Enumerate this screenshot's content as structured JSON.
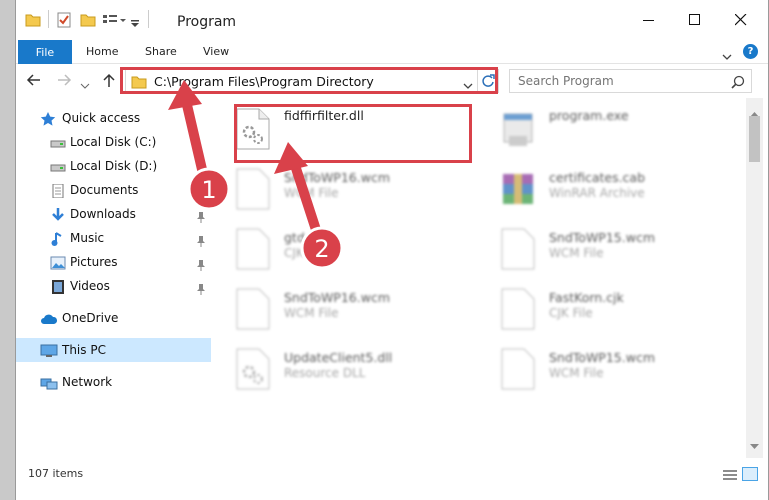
{
  "window": {
    "title": "Program",
    "min_icon": "minimize-icon",
    "max_icon": "maximize-icon",
    "close_icon": "close-icon"
  },
  "ribbon": {
    "tabs": [
      "File",
      "Home",
      "Share",
      "View"
    ],
    "help": "?"
  },
  "address": {
    "path": "C:\\Program Files\\Program Directory"
  },
  "search": {
    "placeholder": "Search Program"
  },
  "nav": {
    "items": [
      {
        "label": "Quick access",
        "icon": "star-icon"
      },
      {
        "label": "Local Disk (C:)",
        "icon": "drive-icon"
      },
      {
        "label": "Local Disk (D:)",
        "icon": "drive-icon"
      },
      {
        "label": "Documents",
        "icon": "documents-icon"
      },
      {
        "label": "Downloads",
        "icon": "download-icon"
      },
      {
        "label": "Music",
        "icon": "music-icon"
      },
      {
        "label": "Pictures",
        "icon": "pictures-icon"
      },
      {
        "label": "Videos",
        "icon": "videos-icon"
      },
      {
        "label": "OneDrive",
        "icon": "cloud-icon"
      },
      {
        "label": "This PC",
        "icon": "computer-icon"
      },
      {
        "label": "Network",
        "icon": "network-icon"
      }
    ]
  },
  "files": [
    {
      "name": "fidffirfilter.dll",
      "type": ""
    },
    {
      "name": "program.exe",
      "type": ""
    },
    {
      "name": "SndToWP16.wcm",
      "type": "WCM File"
    },
    {
      "name": "certificates.cab",
      "type": "WinRAR Archive"
    },
    {
      "name": "gtd.cjk",
      "type": "CJK File"
    },
    {
      "name": "SndToWP15.wcm",
      "type": "WCM File"
    },
    {
      "name": "SndToWP16.wcm",
      "type": "WCM File"
    },
    {
      "name": "FastKorn.cjk",
      "type": "CJK File"
    },
    {
      "name": "UpdateClient5.dll",
      "type": "Resource DLL"
    },
    {
      "name": "SndToWP15.wcm",
      "type": "WCM File"
    }
  ],
  "status": {
    "item_count": "107 items"
  },
  "annotations": {
    "label_1": "1",
    "label_2": "2",
    "color": "#d9414a"
  },
  "colors": {
    "accent": "#1979ca",
    "selected": "#cce8ff"
  }
}
